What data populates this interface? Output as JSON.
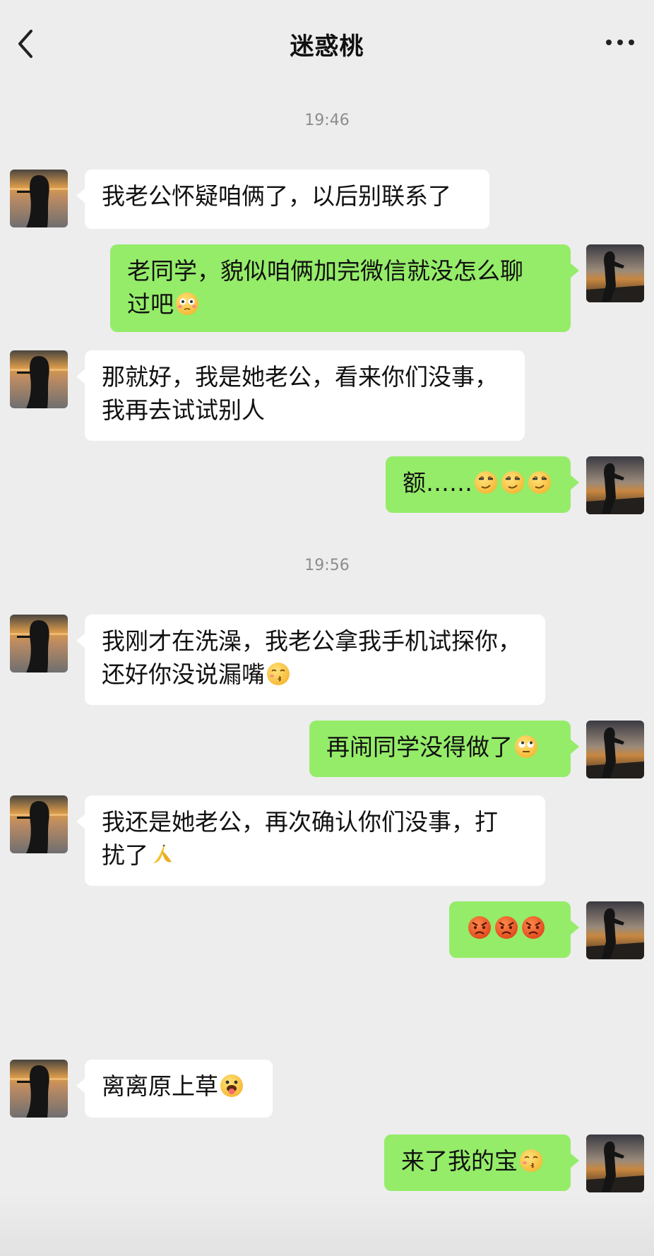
{
  "header": {
    "title": "迷惑桃"
  },
  "timestamps": [
    "19:46",
    "19:56"
  ],
  "messages": [
    {
      "side": "in",
      "line1": "我老公怀疑咱俩了，以后别联系了",
      "line2": ""
    },
    {
      "side": "out",
      "line1": "老同学，貌似咱俩加完微信就没怎么聊",
      "line2": "过吧",
      "emoji": "flushed-emoji"
    },
    {
      "side": "in",
      "line1": "那就好，我是她老公，看来你们没事，",
      "line2": "我再去试试别人"
    },
    {
      "side": "out",
      "line1": "额……",
      "emoji": "smirk-emoji x3"
    },
    {
      "side": "in",
      "line1": "我刚才在洗澡，我老公拿我手机试探你，",
      "line2": "还好你没说漏嘴",
      "emoji": "kiss-emoji"
    },
    {
      "side": "out",
      "line1": "再闹同学没得做了",
      "emoji": "eye-roll-emoji"
    },
    {
      "side": "in",
      "line1": "我还是她老公，再次确认你们没事，打",
      "line2": "扰了",
      "emoji": "banana-emoji"
    },
    {
      "side": "out",
      "line1": "",
      "emoji": "angry-face-emoji x3"
    },
    {
      "side": "in",
      "line1": "离离原上草",
      "emoji": "tongue-out-emoji"
    },
    {
      "side": "out",
      "line1": "来了我的宝",
      "emoji": "kiss-emoji"
    }
  ],
  "colors": {
    "background": "#ededed",
    "incoming_bubble": "#ffffff",
    "outgoing_bubble": "#95ec69",
    "timestamp": "#8d8d8d"
  }
}
